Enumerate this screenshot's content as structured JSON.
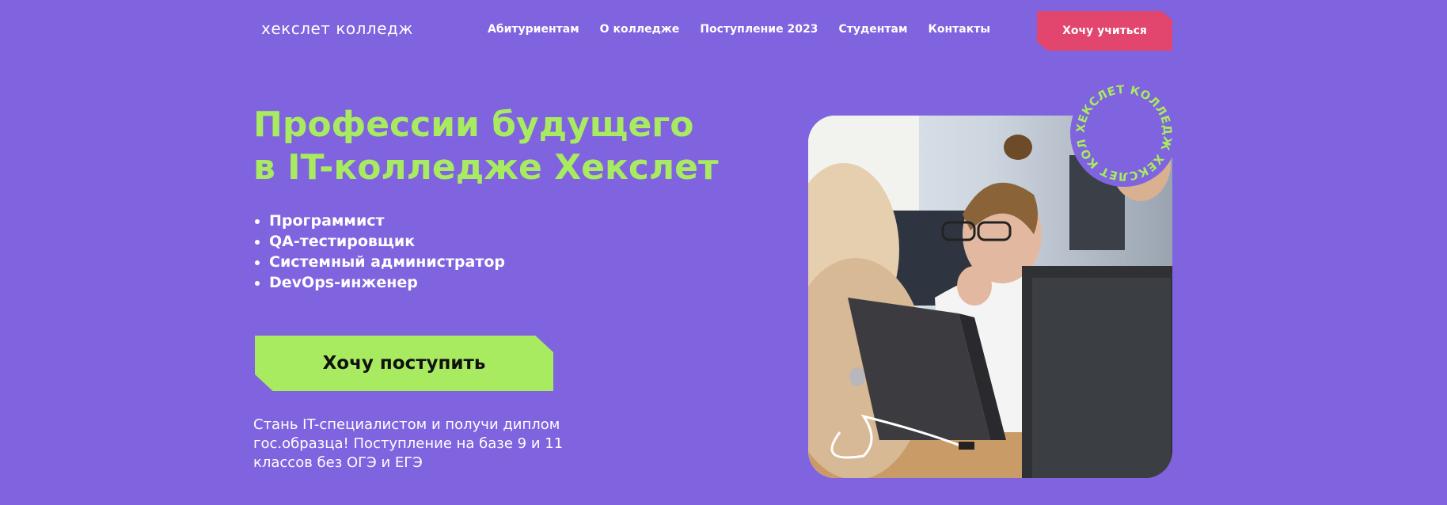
{
  "header": {
    "logo": "хекслет колледж",
    "nav": [
      "Абитуриентам",
      "О колледже",
      "Поступление 2023",
      "Студентам",
      "Контакты"
    ],
    "cta": "Хочу учиться"
  },
  "hero": {
    "title_line1": "Профессии будущего",
    "title_line2": "в IT-колледже Хекслет",
    "professions": [
      "Программист",
      "QA-тестировщик",
      "Системный администратор",
      "DevOps-инженер"
    ],
    "cta": "Хочу поступить",
    "description": "Стань IT-специалистом и получи диплом гос.образца! Поступление на базе 9 и 11 классов без ОГЭ и ЕГЭ"
  },
  "badge": {
    "text": "ХЕКСЛЕТ КОЛЛЕДЖ ХЕКСЛЕТ КОЛЛЕДЖ "
  },
  "colors": {
    "background": "#7F63DF",
    "accent_green": "#A8EB60",
    "accent_pink": "#E2456E",
    "text": "#FFFFFF"
  }
}
